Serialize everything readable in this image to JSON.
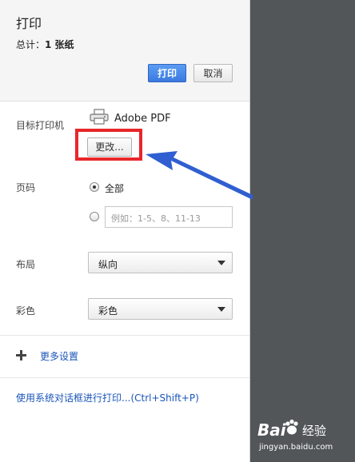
{
  "dialog": {
    "title": "打印",
    "total_label": "总计：",
    "total_value": "1 张纸",
    "print_button": "打印",
    "cancel_button": "取消"
  },
  "destination": {
    "label": "目标打印机",
    "printer_name": "Adobe PDF",
    "change_button": "更改..."
  },
  "pages": {
    "label": "页码",
    "option_all": "全部",
    "custom_placeholder": "例如：1-5、8、11-13",
    "selected": "全部"
  },
  "layout": {
    "label": "布局",
    "value": "纵向"
  },
  "color": {
    "label": "彩色",
    "value": "彩色"
  },
  "more_settings": "更多设置",
  "system_dialog_link": "使用系统对话框进行打印...(Ctrl+Shift+P)",
  "watermark": {
    "logo_text": "Bai",
    "logo_suffix": "经验",
    "url": "jingyan.baidu.com"
  },
  "colors": {
    "accent_blue": "#3b7ae0",
    "highlight_red": "#e8262a",
    "arrow_blue": "#2f5fd0",
    "preview_bg": "#525659",
    "link_blue": "#1a55b8"
  },
  "icons": {
    "printer": "printer-icon",
    "plus": "plus-icon",
    "dropdown": "caret-down-icon",
    "annotation": "arrow-icon"
  }
}
